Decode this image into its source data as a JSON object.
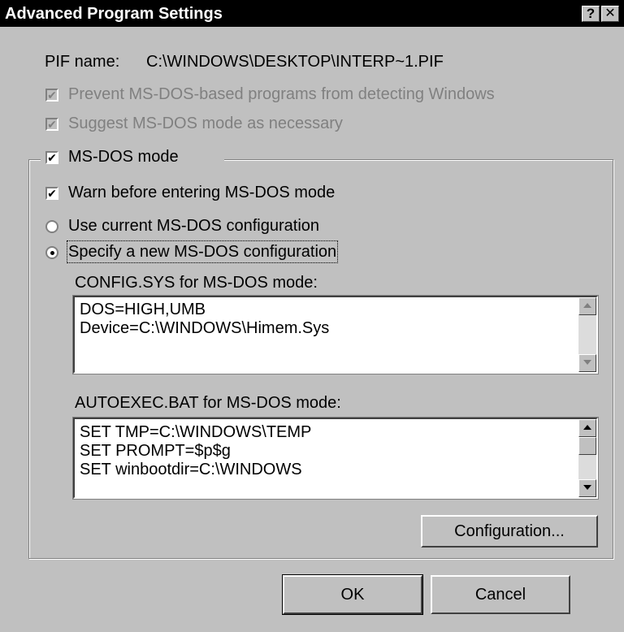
{
  "window": {
    "title": "Advanced Program Settings",
    "help_label": "?",
    "close_label": "✕"
  },
  "pif": {
    "label": "PIF name:",
    "value": "C:\\WINDOWS\\DESKTOP\\INTERP~1.PIF"
  },
  "options": {
    "prevent_detect": {
      "label": "Prevent MS-DOS-based programs from detecting Windows",
      "checked": true,
      "disabled": true
    },
    "suggest_msdos": {
      "label": "Suggest MS-DOS mode as necessary",
      "checked": true,
      "disabled": true
    }
  },
  "msdos_group": {
    "label": "MS-DOS mode",
    "checked": true,
    "warn": {
      "label": "Warn before entering MS-DOS mode",
      "checked": true
    },
    "radio_current": {
      "label": "Use current MS-DOS configuration",
      "selected": false
    },
    "radio_new": {
      "label": "Specify a new MS-DOS configuration",
      "selected": true
    },
    "config_sys": {
      "label": "CONFIG.SYS for MS-DOS mode:",
      "lines": [
        "DOS=HIGH,UMB",
        "Device=C:\\WINDOWS\\Himem.Sys"
      ]
    },
    "autoexec_bat": {
      "label": "AUTOEXEC.BAT for MS-DOS mode:",
      "lines": [
        "SET TMP=C:\\WINDOWS\\TEMP",
        "SET PROMPT=$p$g",
        "SET winbootdir=C:\\WINDOWS"
      ]
    },
    "configuration_button": "Configuration..."
  },
  "buttons": {
    "ok": "OK",
    "cancel": "Cancel"
  },
  "check_glyph": "✔"
}
